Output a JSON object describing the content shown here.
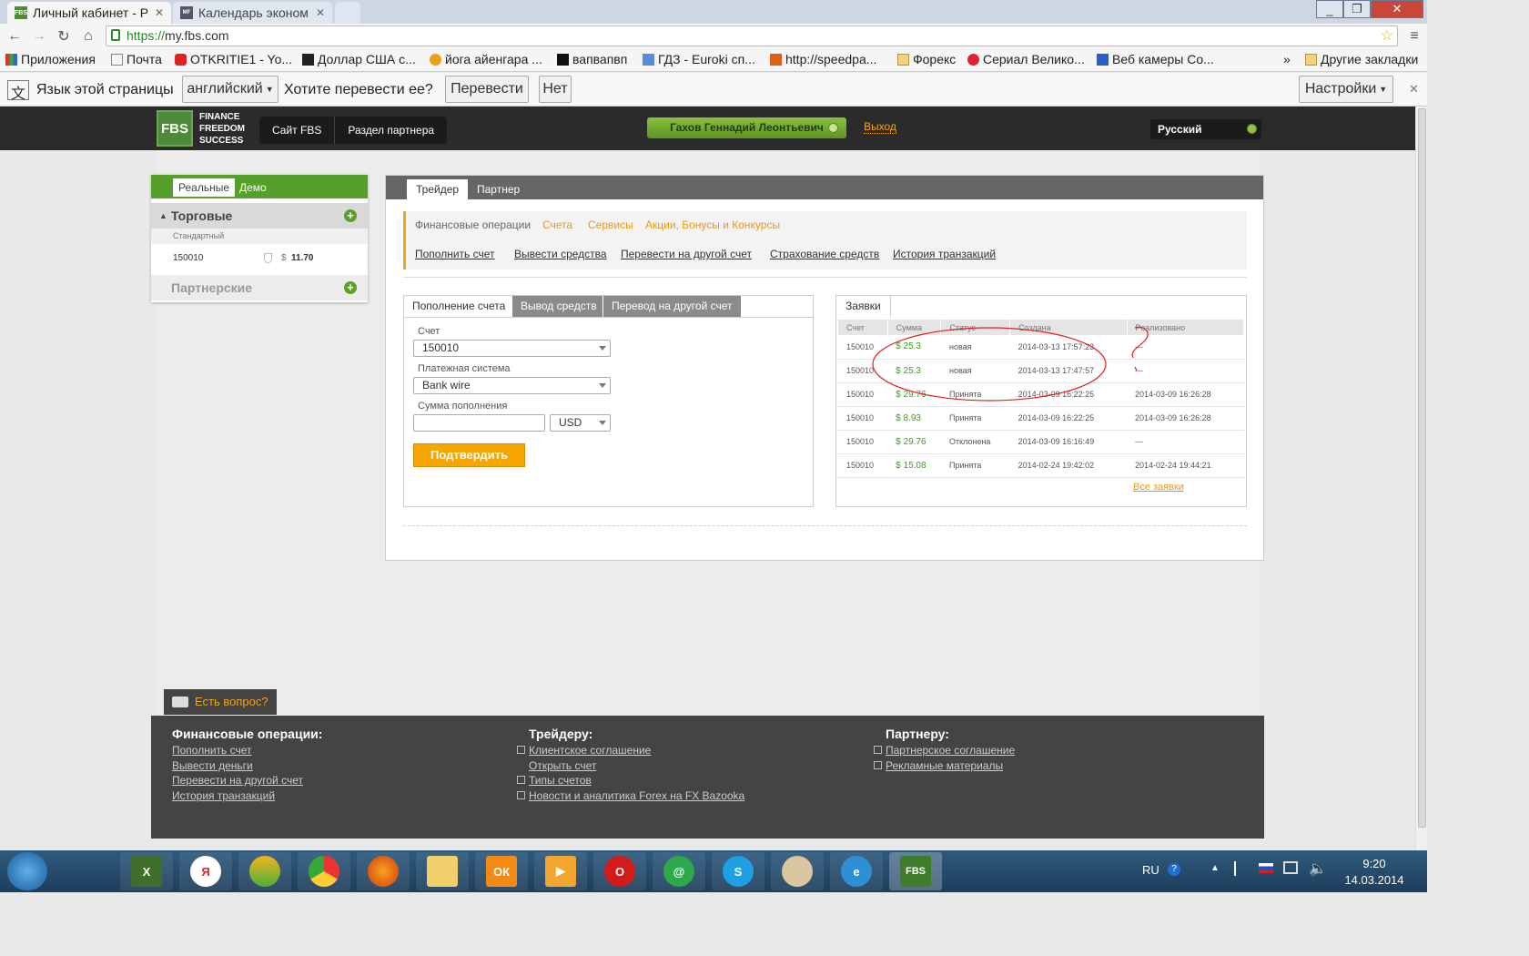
{
  "browser": {
    "tabs": [
      {
        "title": "Личный кабинет - Р"
      },
      {
        "title": "Календарь эконом"
      }
    ],
    "url_scheme": "https://",
    "url_host": "my.fbs.com",
    "bookmarks": [
      "Приложения",
      "Почта",
      "OTKRITIE1 - Yo...",
      "Доллар США с...",
      "йога айенгара ...",
      "вапвапвп",
      "ГДЗ - Euroki сп...",
      "http://speedpa...",
      "Форекс",
      "Сериал Велико...",
      "Веб камеры Со..."
    ],
    "bookmarks_more": "»",
    "other_bookmarks": "Другие закладки",
    "translate": {
      "label": "Язык этой страницы",
      "language": "английский",
      "question": "Хотите перевести ее?",
      "translate_btn": "Перевести",
      "no_btn": "Нет",
      "settings_btn": "Настройки"
    }
  },
  "site": {
    "logo": "FBS",
    "logo_text": [
      "FINANCE",
      "FREEDOM",
      "SUCCESS"
    ],
    "nav": [
      "Сайт FBS",
      "Раздел партнера"
    ],
    "username": "Гахов Геннадий Леонтьевич",
    "logout": "Выход",
    "language": "Русский"
  },
  "left": {
    "tabs": [
      "Реальные",
      "Демо"
    ],
    "trading_title": "Торговые",
    "account_type": "Стандартный",
    "account_number": "150010",
    "balance_currency": "$",
    "balance": "11.70",
    "partner_title": "Партнерские"
  },
  "main": {
    "tabs": [
      "Трейдер",
      "Партнер"
    ],
    "menu1": [
      "Финансовые операции",
      "Счета",
      "Сервисы",
      "Акции, Бонусы и Конкурсы"
    ],
    "menu2": [
      "Пополнить счет",
      "Вывести средства",
      "Перевести на другой счет",
      "Страхование средств",
      "История транзакций"
    ],
    "form": {
      "tabs": [
        "Пополнение счета",
        "Вывод средств",
        "Перевод на другой счет"
      ],
      "account_label": "Счет",
      "account_value": "150010",
      "payment_label": "Платежная система",
      "payment_value": "Bank wire",
      "amount_label": "Сумма пополнения",
      "amount_value": "",
      "currency": "USD",
      "submit": "Подтвердить"
    },
    "orders": {
      "tab": "Заявки",
      "columns": [
        "Счет",
        "Сумма",
        "Статус",
        "Создана",
        "Реализовано"
      ],
      "rows": [
        [
          "150010",
          "$ 25.3",
          "новая",
          "2014-03-13 17:57:23",
          "---"
        ],
        [
          "150010",
          "$ 25.3",
          "новая",
          "2014-03-13 17:47:57",
          "---"
        ],
        [
          "150010",
          "$ 29.76",
          "Принята",
          "2014-03-09 16:22:25",
          "2014-03-09 16:26:28"
        ],
        [
          "150010",
          "$ 8.93",
          "Принята",
          "2014-03-09 16:22:25",
          "2014-03-09 16:26:28"
        ],
        [
          "150010",
          "$ 29.76",
          "Отклонена",
          "2014-03-09 16:16:49",
          "---"
        ],
        [
          "150010",
          "$ 15.08",
          "Принята",
          "2014-02-24 19:42:02",
          "2014-02-24 19:44:21"
        ]
      ],
      "all_link": "Все заявки"
    }
  },
  "footer": {
    "question": "Есть вопрос?",
    "col1_title": "Финансовые операции:",
    "col1": [
      "Пополнить счет",
      "Вывести деньги",
      "Перевести на другой счет",
      "История транзакций"
    ],
    "col2_title": "Трейдеру:",
    "col2": [
      "Клиентское соглашение",
      "Открыть счет",
      "Типы счетов",
      "Новости и аналитика Forex на FX Bazooka"
    ],
    "col3_title": "Партнеру:",
    "col3": [
      "Партнерское соглашение",
      "Рекламные материалы"
    ]
  },
  "taskbar": {
    "lang": "RU",
    "time": "9:20",
    "date": "14.03.2014",
    "fbs_label": "FBS"
  }
}
